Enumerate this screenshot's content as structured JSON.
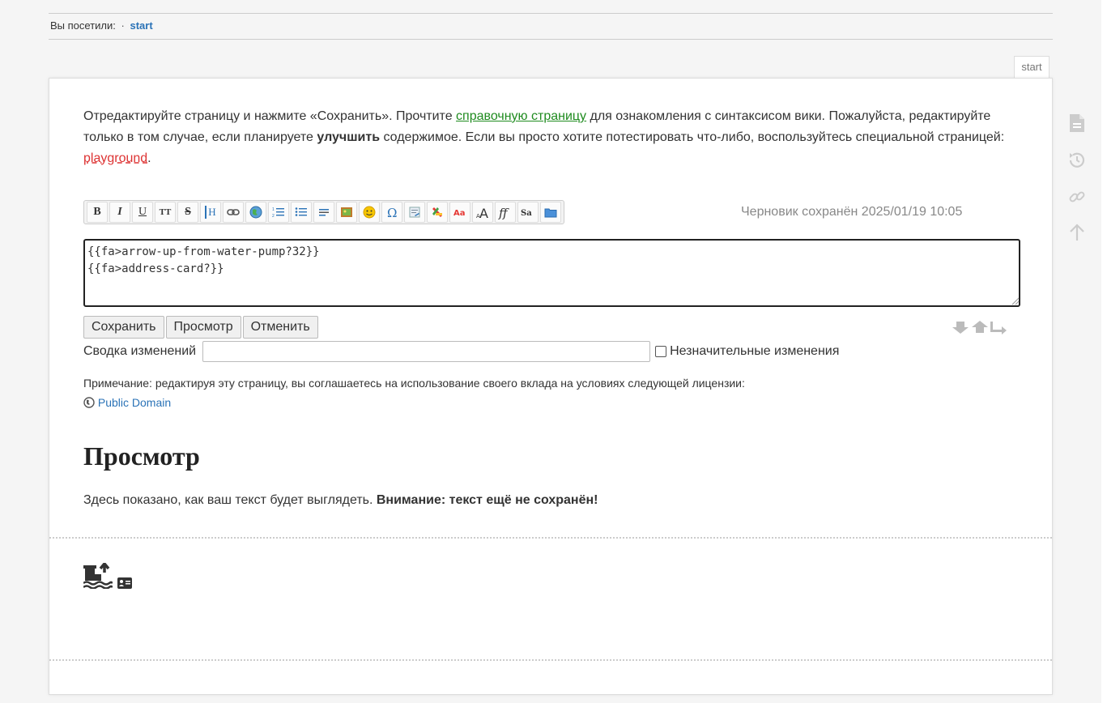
{
  "breadcrumbs": {
    "label": "Вы посетили:",
    "separator": "·",
    "link": "start"
  },
  "page_tab": "start",
  "intro": {
    "part1": "Отредактируйте страницу и нажмите «Сохранить». Прочтите ",
    "help_link": "справочную страницу",
    "part2": " для ознакомления с синтаксисом вики. Пожалуйста, редактируйте только в том случае, если планируете ",
    "bold": "улучшить",
    "part3": " содержимое. Если вы просто хотите потестировать что-либо, воспользуйтесь специальной страницей: ",
    "playground_link": "playground",
    "part4": "."
  },
  "toolbar": {
    "bold": "B",
    "italic": "I",
    "underline": "U",
    "monospace": "TT",
    "strike": "S",
    "heading": "H",
    "draft_status": "Черновик сохранён 2025/01/19 10:05"
  },
  "editor": {
    "text": "{{fa>arrow-up-from-water-pump?32}}\n{{fa>address-card?}}"
  },
  "buttons": {
    "save": "Сохранить",
    "preview": "Просмотр",
    "cancel": "Отменить"
  },
  "summary": {
    "label": "Сводка изменений",
    "minor_label": "Незначительные изменения"
  },
  "license": {
    "text": "Примечание: редактируя эту страницу, вы соглашаетесь на использование своего вклада на условиях следующей лицензии:",
    "link": "Public Domain"
  },
  "preview": {
    "title": "Просмотр",
    "note_plain": "Здесь показано, как ваш текст будет выглядеть. ",
    "note_bold": "Внимание: текст ещё не сохранён!"
  },
  "colors": {
    "link": "#2b73b7",
    "help_link": "#1f8b1f",
    "missing_link": "#d33",
    "page_bg": "#ffffff",
    "body_bg": "#f5f5f5"
  },
  "side_icons": [
    "file-icon",
    "history-icon",
    "backlink-icon",
    "arrow-up-icon"
  ]
}
